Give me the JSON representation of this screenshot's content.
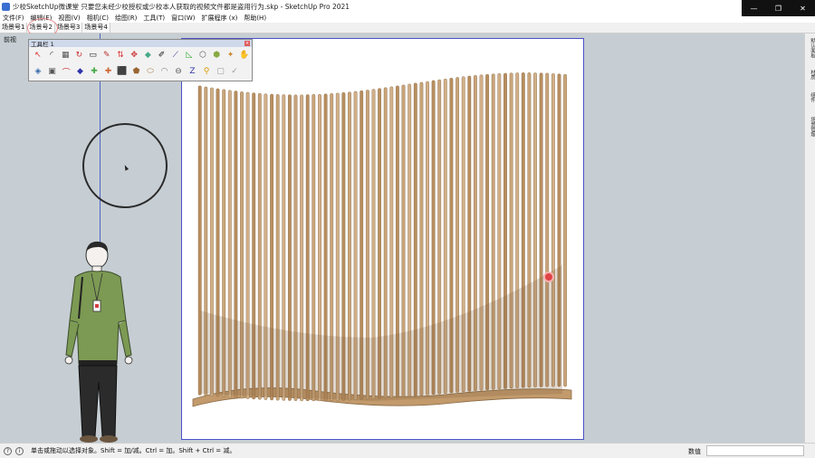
{
  "window": {
    "title": "少校SketchUp微课堂 只要您未经少校授权或少校本人获取的视频文件都是盗用行为.skp - SketchUp Pro 2021",
    "controls": [
      "—",
      "❐",
      "✕"
    ]
  },
  "menu": [
    "文件(F)",
    "编辑(E)",
    "视图(V)",
    "相机(C)",
    "绘图(R)",
    "工具(T)",
    "窗口(W)",
    "扩展程序 (x)",
    "帮助(H)"
  ],
  "scene_tabs": [
    "场景号1",
    "场景号2",
    "场景号3",
    "场景号4"
  ],
  "active_scene_tab": 1,
  "viewport": {
    "label": "前视"
  },
  "toolbar": {
    "title": "工具栏 1",
    "close": "×"
  },
  "right_panel": [
    "默认面板",
    "材质",
    "组件",
    "场景管理"
  ],
  "status": {
    "text": "单击或拖动以选择对象。Shift = 加/减。Ctrl = 加。Shift + Ctrl = 减。",
    "measure_label": "数值",
    "measure_value": ""
  },
  "colors": {
    "viewport_bg": "#c6ced3",
    "selection_blue": "#4a50c8",
    "wood": "#c9a57a",
    "highlight": "#e04444"
  }
}
